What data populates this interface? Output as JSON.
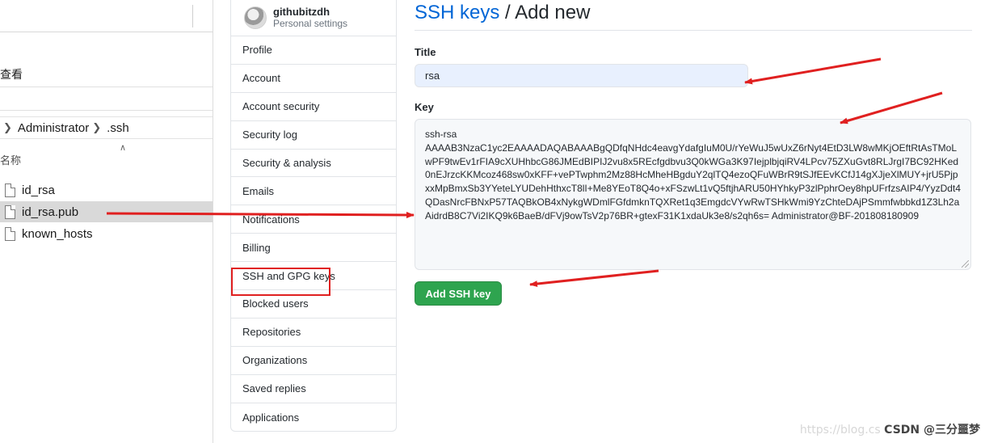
{
  "explorer": {
    "ribbon_tab": "查看",
    "address": {
      "segments": [
        "Administrator",
        ".ssh"
      ]
    },
    "column_header": "名称",
    "files": [
      {
        "name": "id_rsa",
        "selected": false
      },
      {
        "name": "id_rsa.pub",
        "selected": true
      },
      {
        "name": "known_hosts",
        "selected": false
      }
    ]
  },
  "sidebar": {
    "user": {
      "name": "githubitzdh",
      "subtitle": "Personal settings"
    },
    "items": [
      {
        "label": "Profile"
      },
      {
        "label": "Account"
      },
      {
        "label": "Account security"
      },
      {
        "label": "Security log"
      },
      {
        "label": "Security & analysis"
      },
      {
        "label": "Emails"
      },
      {
        "label": "Notifications"
      },
      {
        "label": "Billing"
      },
      {
        "label": "SSH and GPG keys"
      },
      {
        "label": "Blocked users"
      },
      {
        "label": "Repositories"
      },
      {
        "label": "Organizations"
      },
      {
        "label": "Saved replies"
      },
      {
        "label": "Applications"
      }
    ]
  },
  "header": {
    "link": "SSH keys",
    "separator": " / ",
    "current": "Add new"
  },
  "form": {
    "title_label": "Title",
    "title_value": "rsa",
    "key_label": "Key",
    "key_value": "ssh-rsa\nAAAAB3NzaC1yc2EAAAADAQABAAABgQDfqNHdc4eavgYdafgIuM0U/rYeWuJ5wUxZ6rNyt4EtD3LW8wMKjOEftRtAsTMoLwPF9twEv1rFIA9cXUHhbcG86JMEdBIPIJ2vu8x5REcfgdbvu3Q0kWGa3K97IejplbjqiRV4LPcv75ZXuGvt8RLJrgI7BC92HKed0nEJrzcKKMcoz468sw0xKFF+vePTwphm2Mz88HcMheHBgduY2qlTQ4ezoQFuWBrR9tSJfEEvKCfJ14gXJjeXlMUY+jrU5PjpxxMpBmxSb3YYeteLYUDehHthxcT8lI+Me8YEoT8Q4o+xFSzwLt1vQ5ftjhARU50HYhkyP3zlPphrOey8hpUFrfzsAIP4/YyzDdt4QDasNrcFBNxP57TAQBkOB4xNykgWDmlFGfdmknTQXRet1q3EmgdcVYwRwTSHkWmi9YzChteDAjPSmmfwbbkd1Z3Lh2aAidrdB8C7Vi2IKQ9k6BaeB/dFVj9owTsV2p76BR+gtexF31K1xdaUk3e8/s2qh6s= Administrator@BF-201808180909",
    "submit_label": "Add SSH key"
  },
  "annotations": {
    "arrow_color": "#e02020",
    "box_color": "#e02020"
  },
  "watermark": {
    "prefix": "https://blog.cs",
    "brand": "CSDN @三分噩梦"
  }
}
